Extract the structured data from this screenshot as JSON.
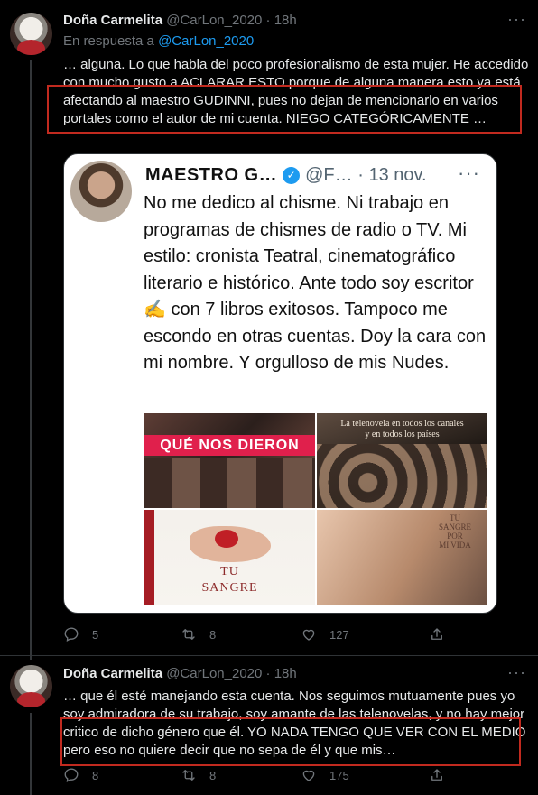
{
  "tweets": [
    {
      "display_name": "Doña Carmelita",
      "handle": "@CarLon_2020",
      "dot": "·",
      "time": "18h",
      "reply_prefix": "En respuesta a ",
      "reply_handle": "@CarLon_2020",
      "text": "… alguna. Lo que habla del poco profesionalismo de esta mujer. He accedido con mucho gusto a ACLARAR ESTO porque de alguna manera esto ya está afectando al maestro GUDINNI, pues no dejan de mencionarlo en varios portales como el autor de mi cuenta. NIEGO CATEGÓRICAMENTE …",
      "embed": {
        "name": "MAESTRO G…",
        "handle": "@F…",
        "dot": "·",
        "time": "13 nov.",
        "text": "No me dedico al chisme. Ni trabajo en programas de chismes de radio o TV. Mi estilo: cronista Teatral, cinematográfico literario e histórico. Ante todo soy escritor ✍️ con 7 libros exitosos. Tampoco me escondo en otras cuentas. Doy la cara con mi nombre. Y orgulloso de mis Nudes.",
        "collage": {
          "tile1_title": "QUÉ NOS DIERON",
          "tile2_caption": "La telenovela en todos los canales\ny en todos los países",
          "tile3_title": "TU\nSANGRE",
          "tile4_title": "TU\nSANGRE\nPOR\nMI VIDA"
        }
      },
      "counts": {
        "replies": "5",
        "retweets": "8",
        "likes": "127"
      }
    },
    {
      "display_name": "Doña Carmelita",
      "handle": "@CarLon_2020",
      "dot": "·",
      "time": "18h",
      "text": "… que él esté manejando esta cuenta. Nos seguimos mutuamente pues yo soy admiradora de su trabajo, soy amante de las telenovelas, y no hay mejor critico de dicho género que él. YO NADA TENGO QUE VER CON EL MEDIO pero eso no quiere decir que no sepa de él y que mis…",
      "counts": {
        "replies": "8",
        "retweets": "8",
        "likes": "175"
      }
    }
  ],
  "colors": {
    "background": "#000000",
    "link": "#1d9bf0",
    "highlight_box": "#c12a1f",
    "muted": "#71767b"
  },
  "icons": [
    "more-icon",
    "reply-icon",
    "retweet-icon",
    "like-icon",
    "share-icon",
    "verified-icon"
  ]
}
